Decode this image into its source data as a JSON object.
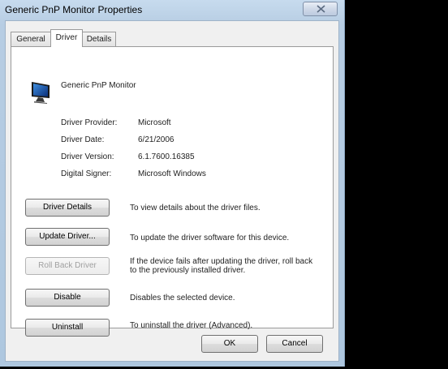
{
  "window": {
    "title": "Generic PnP Monitor Properties"
  },
  "tabs": [
    {
      "label": "General"
    },
    {
      "label": "Driver"
    },
    {
      "label": "Details"
    }
  ],
  "device": {
    "name": "Generic PnP Monitor",
    "icon": "monitor-icon"
  },
  "driver_info": {
    "provider_label": "Driver Provider:",
    "provider_value": "Microsoft",
    "date_label": "Driver Date:",
    "date_value": "6/21/2006",
    "version_label": "Driver Version:",
    "version_value": "6.1.7600.16385",
    "signer_label": "Digital Signer:",
    "signer_value": "Microsoft Windows"
  },
  "actions": {
    "details_label": "Driver Details",
    "details_desc": "To view details about the driver files.",
    "update_label": "Update Driver...",
    "update_desc": "To update the driver software for this device.",
    "rollback_label": "Roll Back Driver",
    "rollback_desc_1": "If the device fails after updating the driver, roll back",
    "rollback_desc_2": "to the previously installed driver.",
    "disable_label": "Disable",
    "disable_desc": "Disables the selected device.",
    "uninstall_label": "Uninstall",
    "uninstall_desc": "To uninstall the driver (Advanced)."
  },
  "footer": {
    "ok_label": "OK",
    "cancel_label": "Cancel"
  }
}
